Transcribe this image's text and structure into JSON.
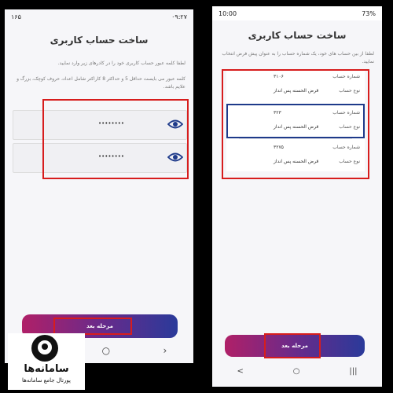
{
  "colors": {
    "red_highlight": "#d71d1d",
    "blue_highlight": "#1e3a8a",
    "button_gradient_start": "#b02068",
    "button_gradient_end": "#2a3a9a",
    "background": "#f6f6f9"
  },
  "left": {
    "status": {
      "time": "۰۹:۲۷",
      "battery": "۱۶۵"
    },
    "title": "ساخت حساب کاربری",
    "instruction1": "لطفا کلمه عبور حساب کاربری خود را در کادرهای زیر وارد نمایید.",
    "instruction2": "کلمه عبور می بایست حداقل 5 و حداکثر 8 کاراکتر شامل اعداد، حروف کوچک، بزرگ و علایم باشد.",
    "password_masked": "••••••••",
    "confirm_masked": "••••••••",
    "next_button": "مرحله بعد",
    "nav": {
      "back": "‹",
      "home": "○",
      "recent": "›"
    }
  },
  "right": {
    "status": {
      "time": "10:00",
      "battery": "73%"
    },
    "title": "ساخت حساب کاربری",
    "instruction": "لطفا از بین حساب های خود، یک شماره حساب را به عنوان پیش فرض انتخاب نمایید.",
    "accounts": [
      {
        "number_label": "شماره حساب",
        "number": "۳۱۰۶",
        "type_label": "نوع حساب",
        "type": "قرض الحسنه پس انداز"
      },
      {
        "number_label": "شماره حساب",
        "number": "۳۲۳",
        "type_label": "نوع حساب",
        "type": "قرض الحسنه پس انداز"
      },
      {
        "number_label": "شماره حساب",
        "number": "۳۲۷۵",
        "type_label": "نوع حساب",
        "type": "قرض الحسنه پس انداز"
      }
    ],
    "next_button": "مرحله بعد",
    "nav": {
      "back": "<",
      "home": "○",
      "recent": "|||"
    }
  },
  "logo": {
    "name": "سامانه‌ها",
    "tagline": "پورتال جامع سامانه‌ها"
  }
}
